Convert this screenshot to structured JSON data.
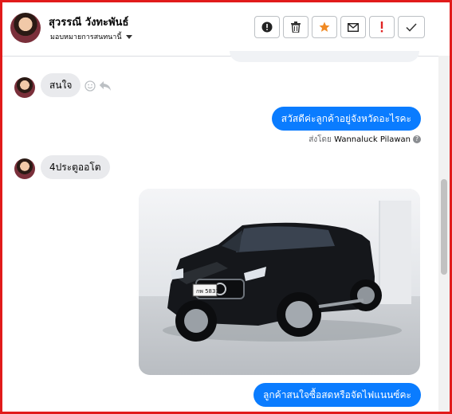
{
  "header": {
    "contact_name": "สุวรรณี วังทะพันธ์",
    "subtitle": "มอบหมายการสนทนานี้",
    "actions": [
      {
        "name": "info-icon"
      },
      {
        "name": "trash-icon"
      },
      {
        "name": "star-icon",
        "color": "#f08a24"
      },
      {
        "name": "mail-icon"
      },
      {
        "name": "exclamation-icon",
        "color": "#e02424"
      },
      {
        "name": "check-icon"
      }
    ]
  },
  "messages": [
    {
      "from": "customer",
      "text": "สนใจ"
    },
    {
      "from": "page",
      "text": "สวัสดีค่ะลูกค้าอยู่จังหวัดอะไรคะ"
    },
    {
      "from": "customer",
      "text": "4ประตูออโต"
    },
    {
      "from": "page",
      "type": "photo",
      "plate": "กพ 5831"
    },
    {
      "from": "page",
      "text": "ลูกค้าสนใจซื้อสดหรือจัดไฟแนนซ์คะ"
    }
  ],
  "sent_by": {
    "prefix": "ส่งโดย",
    "agent": "Wannaluck Pilawan"
  },
  "colors": {
    "accent": "#0a7cff",
    "frame": "#e11b1b"
  }
}
